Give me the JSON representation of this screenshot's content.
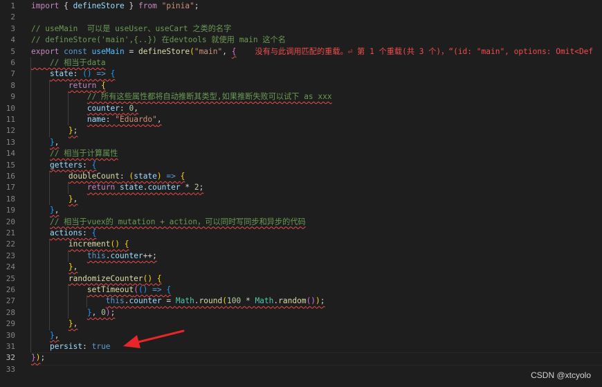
{
  "editor": {
    "active_line": 32,
    "lines": [
      {
        "n": 1,
        "tokens": [
          [
            "import",
            "#c586c0"
          ],
          [
            " { ",
            "#d4d4d4"
          ],
          [
            "defineStore",
            "#9cdcfe"
          ],
          [
            " } ",
            "#d4d4d4"
          ],
          [
            "from",
            "#c586c0"
          ],
          [
            " ",
            "#d4d4d4"
          ],
          [
            "\"pinia\"",
            "#ce9178"
          ],
          [
            ";",
            "#d4d4d4"
          ]
        ]
      },
      {
        "n": 2,
        "tokens": []
      },
      {
        "n": 3,
        "tokens": [
          [
            "// useMain  可以是 useUser、useCart 之类的名字",
            "#6a9955"
          ]
        ]
      },
      {
        "n": 4,
        "tokens": [
          [
            "// defineStore('main',{..}) 在devtools 就使用 main 这个名",
            "#6a9955"
          ]
        ]
      },
      {
        "n": 5,
        "tokens": [
          [
            "export",
            "#c586c0"
          ],
          [
            " ",
            "#d4d4d4"
          ],
          [
            "const",
            "#569cd6"
          ],
          [
            " ",
            "#d4d4d4"
          ],
          [
            "useMain",
            "#4fc1ff"
          ],
          [
            " = ",
            "#d4d4d4"
          ],
          [
            "defineStore",
            "#dcdcaa"
          ],
          [
            "(",
            "#ffd700"
          ],
          [
            "\"main\"",
            "#ce9178"
          ],
          [
            ", ",
            "#d4d4d4"
          ],
          [
            "{",
            "#da70d6"
          ],
          [
            "    ",
            "#d4d4d4"
          ],
          [
            "没有与此调用匹配的重载。⏎ 第 1 个重载(共 3 个)，“(id: \"main\", options: Omit<Def",
            "#f14c4c"
          ]
        ]
      },
      {
        "n": 6,
        "tokens": [
          [
            "    // 相当于data",
            "#6a9955"
          ]
        ]
      },
      {
        "n": 7,
        "tokens": [
          [
            "    ",
            "#d4d4d4"
          ],
          [
            "state",
            "#9cdcfe"
          ],
          [
            ": ",
            "#d4d4d4"
          ],
          [
            "()",
            "#179fff"
          ],
          [
            " => ",
            "#569cd6"
          ],
          [
            "{",
            "#179fff"
          ]
        ]
      },
      {
        "n": 8,
        "tokens": [
          [
            "        ",
            "#d4d4d4"
          ],
          [
            "return",
            "#c586c0"
          ],
          [
            " ",
            "#d4d4d4"
          ],
          [
            "{",
            "#ffd700"
          ]
        ]
      },
      {
        "n": 9,
        "tokens": [
          [
            "            ",
            "#d4d4d4"
          ],
          [
            "// 所有这些属性都将自动推断其类型,如果推断失败可以试下 as xxx",
            "#6a9955"
          ]
        ]
      },
      {
        "n": 10,
        "tokens": [
          [
            "            ",
            "#d4d4d4"
          ],
          [
            "counter",
            "#9cdcfe"
          ],
          [
            ": ",
            "#d4d4d4"
          ],
          [
            "0",
            "#b5cea8"
          ],
          [
            ",",
            "#d4d4d4"
          ]
        ]
      },
      {
        "n": 11,
        "tokens": [
          [
            "            ",
            "#d4d4d4"
          ],
          [
            "name",
            "#9cdcfe"
          ],
          [
            ": ",
            "#d4d4d4"
          ],
          [
            "\"Eduardo\"",
            "#ce9178"
          ],
          [
            ",",
            "#d4d4d4"
          ]
        ]
      },
      {
        "n": 12,
        "tokens": [
          [
            "        ",
            "#d4d4d4"
          ],
          [
            "}",
            "#ffd700"
          ],
          [
            ";",
            "#d4d4d4"
          ]
        ]
      },
      {
        "n": 13,
        "tokens": [
          [
            "    ",
            "#d4d4d4"
          ],
          [
            "}",
            "#179fff"
          ],
          [
            ",",
            "#d4d4d4"
          ]
        ]
      },
      {
        "n": 14,
        "tokens": [
          [
            "    ",
            "#d4d4d4"
          ],
          [
            "// 相当于计算属性",
            "#6a9955"
          ]
        ]
      },
      {
        "n": 15,
        "tokens": [
          [
            "    ",
            "#d4d4d4"
          ],
          [
            "getters",
            "#9cdcfe"
          ],
          [
            ": ",
            "#d4d4d4"
          ],
          [
            "{",
            "#179fff"
          ]
        ]
      },
      {
        "n": 16,
        "tokens": [
          [
            "        ",
            "#d4d4d4"
          ],
          [
            "doubleCount",
            "#dcdcaa"
          ],
          [
            ": ",
            "#d4d4d4"
          ],
          [
            "(",
            "#ffd700"
          ],
          [
            "state",
            "#9cdcfe"
          ],
          [
            ")",
            "#ffd700"
          ],
          [
            " => ",
            "#569cd6"
          ],
          [
            "{",
            "#ffd700"
          ]
        ]
      },
      {
        "n": 17,
        "tokens": [
          [
            "            ",
            "#d4d4d4"
          ],
          [
            "return",
            "#c586c0"
          ],
          [
            " ",
            "#d4d4d4"
          ],
          [
            "state",
            "#9cdcfe"
          ],
          [
            ".",
            "#d4d4d4"
          ],
          [
            "counter",
            "#9cdcfe"
          ],
          [
            " * ",
            "#d4d4d4"
          ],
          [
            "2",
            "#b5cea8"
          ],
          [
            ";",
            "#d4d4d4"
          ]
        ]
      },
      {
        "n": 18,
        "tokens": [
          [
            "        ",
            "#d4d4d4"
          ],
          [
            "}",
            "#ffd700"
          ],
          [
            ",",
            "#d4d4d4"
          ]
        ]
      },
      {
        "n": 19,
        "tokens": [
          [
            "    ",
            "#d4d4d4"
          ],
          [
            "}",
            "#179fff"
          ],
          [
            ",",
            "#d4d4d4"
          ]
        ]
      },
      {
        "n": 20,
        "tokens": [
          [
            "    ",
            "#d4d4d4"
          ],
          [
            "// 相当于vuex的 mutation + action，可以同时写同步和异步的代码",
            "#6a9955"
          ]
        ]
      },
      {
        "n": 21,
        "tokens": [
          [
            "    ",
            "#d4d4d4"
          ],
          [
            "actions",
            "#9cdcfe"
          ],
          [
            ": ",
            "#d4d4d4"
          ],
          [
            "{",
            "#179fff"
          ]
        ]
      },
      {
        "n": 22,
        "tokens": [
          [
            "        ",
            "#d4d4d4"
          ],
          [
            "increment",
            "#dcdcaa"
          ],
          [
            "()",
            "#ffd700"
          ],
          [
            " ",
            "#d4d4d4"
          ],
          [
            "{",
            "#ffd700"
          ]
        ]
      },
      {
        "n": 23,
        "tokens": [
          [
            "            ",
            "#d4d4d4"
          ],
          [
            "this",
            "#569cd6"
          ],
          [
            ".",
            "#d4d4d4"
          ],
          [
            "counter",
            "#9cdcfe"
          ],
          [
            "++;",
            "#d4d4d4"
          ]
        ]
      },
      {
        "n": 24,
        "tokens": [
          [
            "        ",
            "#d4d4d4"
          ],
          [
            "}",
            "#ffd700"
          ],
          [
            ",",
            "#d4d4d4"
          ]
        ]
      },
      {
        "n": 25,
        "tokens": [
          [
            "        ",
            "#d4d4d4"
          ],
          [
            "randomizeCounter",
            "#dcdcaa"
          ],
          [
            "()",
            "#ffd700"
          ],
          [
            " ",
            "#d4d4d4"
          ],
          [
            "{",
            "#ffd700"
          ]
        ]
      },
      {
        "n": 26,
        "tokens": [
          [
            "            ",
            "#d4d4d4"
          ],
          [
            "setTimeout",
            "#dcdcaa"
          ],
          [
            "(",
            "#da70d6"
          ],
          [
            "()",
            "#179fff"
          ],
          [
            " => ",
            "#569cd6"
          ],
          [
            "{",
            "#179fff"
          ]
        ]
      },
      {
        "n": 27,
        "tokens": [
          [
            "                ",
            "#d4d4d4"
          ],
          [
            "this",
            "#569cd6"
          ],
          [
            ".",
            "#d4d4d4"
          ],
          [
            "counter",
            "#9cdcfe"
          ],
          [
            " = ",
            "#d4d4d4"
          ],
          [
            "Math",
            "#4ec9b0"
          ],
          [
            ".",
            "#d4d4d4"
          ],
          [
            "round",
            "#dcdcaa"
          ],
          [
            "(",
            "#ffd700"
          ],
          [
            "100",
            "#b5cea8"
          ],
          [
            " * ",
            "#d4d4d4"
          ],
          [
            "Math",
            "#4ec9b0"
          ],
          [
            ".",
            "#d4d4d4"
          ],
          [
            "random",
            "#dcdcaa"
          ],
          [
            "()",
            "#da70d6"
          ],
          [
            ")",
            "#ffd700"
          ],
          [
            ";",
            "#d4d4d4"
          ]
        ]
      },
      {
        "n": 28,
        "tokens": [
          [
            "            ",
            "#d4d4d4"
          ],
          [
            "}",
            "#179fff"
          ],
          [
            ", ",
            "#d4d4d4"
          ],
          [
            "0",
            "#b5cea8"
          ],
          [
            ")",
            "#da70d6"
          ],
          [
            ";",
            "#d4d4d4"
          ]
        ]
      },
      {
        "n": 29,
        "tokens": [
          [
            "        ",
            "#d4d4d4"
          ],
          [
            "}",
            "#ffd700"
          ],
          [
            ",",
            "#d4d4d4"
          ]
        ]
      },
      {
        "n": 30,
        "tokens": [
          [
            "    ",
            "#d4d4d4"
          ],
          [
            "}",
            "#179fff"
          ],
          [
            ",",
            "#d4d4d4"
          ]
        ]
      },
      {
        "n": 31,
        "tokens": [
          [
            "    ",
            "#d4d4d4"
          ],
          [
            "persist",
            "#9cdcfe"
          ],
          [
            ": ",
            "#d4d4d4"
          ],
          [
            "true",
            "#569cd6"
          ]
        ]
      },
      {
        "n": 32,
        "tokens": [
          [
            "}",
            "#da70d6"
          ],
          [
            ")",
            "#ffd700"
          ],
          [
            ";",
            "#d4d4d4"
          ]
        ]
      },
      {
        "n": 33,
        "tokens": []
      }
    ]
  },
  "watermark": "CSDN @xtcyolo",
  "colors": {
    "background": "#1e1e1e",
    "error": "#f14c4c",
    "arrow": "#e8262a"
  }
}
